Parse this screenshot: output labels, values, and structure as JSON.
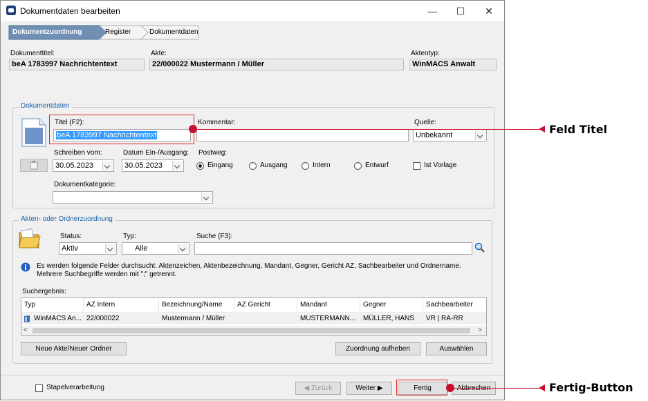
{
  "window": {
    "title": "Dokumentdaten bearbeiten",
    "controls": {
      "minimize": "—",
      "maximize": "☐",
      "close": "✕"
    }
  },
  "wizard": {
    "steps": [
      "Dokumentzuordnung",
      "Register",
      "Dokumentdaten"
    ],
    "active": 0
  },
  "header": {
    "dokumenttitel": {
      "label": "Dokumenttitel:",
      "value": "beA 1783997 Nachrichtentext"
    },
    "akte": {
      "label": "Akte:",
      "value": "22/000022 Mustermann / Müller"
    },
    "aktentyp": {
      "label": "Aktentyp:",
      "value": "WinMACS Anwalt"
    }
  },
  "dokumentdaten": {
    "group_title": "Dokumentdaten",
    "titel": {
      "label": "Titel (F2):",
      "value": "beA 1783997 Nachrichtentext"
    },
    "kommentar": {
      "label": "Kommentar:",
      "value": ""
    },
    "quelle": {
      "label": "Quelle:",
      "value": "Unbekannt"
    },
    "schreiben_vom": {
      "label": "Schreiben vom:",
      "value": "30.05.2023"
    },
    "datum_ein_ausgang": {
      "label": "Datum Ein-/Ausgang:",
      "value": "30.05.2023"
    },
    "postweg": {
      "label": "Postweg:",
      "options": [
        "Eingang",
        "Ausgang",
        "Intern",
        "Entwurf"
      ],
      "selected": 0
    },
    "ist_vorlage": {
      "label": "Ist Vorlage",
      "checked": false
    },
    "dokumentkategorie": {
      "label": "Dokumentkategorie:",
      "value": ""
    }
  },
  "zuordnung": {
    "group_title": "Akten- oder Ordnerzuordnung",
    "status": {
      "label": "Status:",
      "value": "Aktiv"
    },
    "typ": {
      "label": "Typ:",
      "value": "Alle"
    },
    "suche": {
      "label": "Suche (F3):",
      "value": ""
    },
    "info_text": "Es werden folgende Felder durchsucht: Aktenzeichen, Aktenbezeichnung, Mandant, Gegner, Gericht AZ, Sachbearbeiter und Ordnername. Mehrere Suchbegriffe werden mit \";\" getrennt.",
    "suchergebnis_label": "Suchergebnis:",
    "columns": [
      "Typ",
      "AZ Intern",
      "Bezeichnung/Name",
      "AZ Gericht",
      "Mandant",
      "Gegner",
      "Sachbearbeiter"
    ],
    "rows": [
      [
        "WinMACS An...",
        "22/000022",
        "Mustermann / Müller",
        "",
        "MUSTERMANN...",
        "MÜLLER, HANS",
        "VR | RA-RR"
      ]
    ],
    "buttons": {
      "neue_akte": "Neue Akte/Neuer Ordner",
      "zuordnung_aufheben": "Zuordnung aufheben",
      "auswaehlen": "Auswählen"
    }
  },
  "footer": {
    "stapelverarbeitung": {
      "label": "Stapelverarbeitung",
      "checked": false
    },
    "zurueck": "◀ Zurück",
    "weiter": "Weiter ▶",
    "fertig": "Fertig",
    "abbrechen": "Abbrechen"
  },
  "annotations": {
    "feld_titel": "Feld Titel",
    "fertig_button": "Fertig-Button"
  },
  "colors": {
    "accent_blue": "#1a5fa8",
    "callout_red": "#c8102e",
    "selection": "#3399ff"
  }
}
